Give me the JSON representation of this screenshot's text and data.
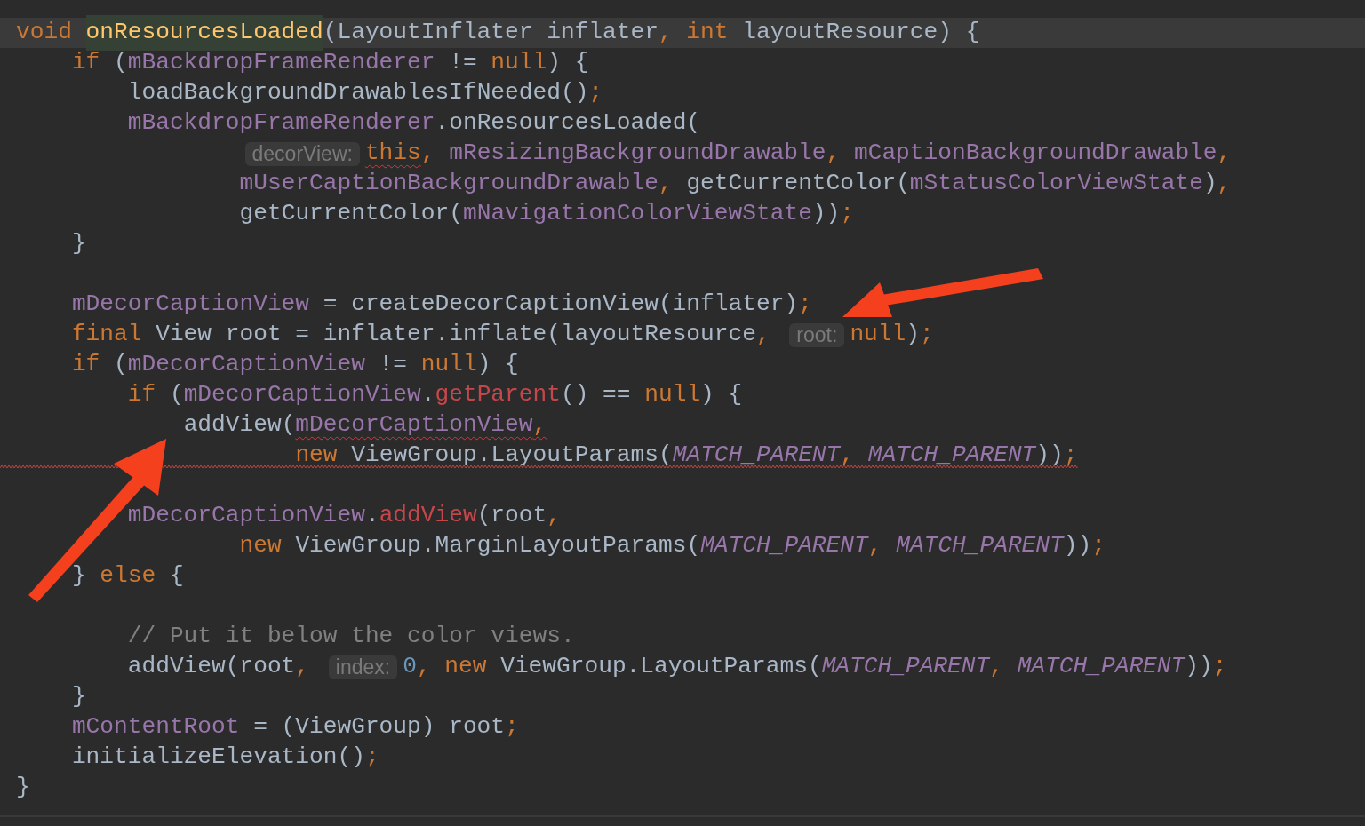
{
  "editor": {
    "lines": [
      {
        "kind": "code",
        "current": true,
        "tokens": [
          {
            "kind": "keyword",
            "text": "void "
          },
          {
            "kind": "declaration",
            "text": "onResourcesLoaded",
            "highlighted": true
          },
          {
            "kind": "plain",
            "text": "(LayoutInflater inflater"
          },
          {
            "kind": "keyword",
            "text": ", int "
          },
          {
            "kind": "plain",
            "text": "layoutResource) {"
          }
        ],
        "children": [
          {
            "kind": "code",
            "tokens": [
              {
                "kind": "keyword",
                "text": "if "
              },
              {
                "kind": "plain",
                "text": "("
              },
              {
                "kind": "field",
                "text": "mBackdropFrameRenderer"
              },
              {
                "kind": "plain",
                "text": " != "
              },
              {
                "kind": "keyword",
                "text": "null"
              },
              {
                "kind": "plain",
                "text": ") {"
              }
            ],
            "children": [
              {
                "kind": "code",
                "tokens": [
                  {
                    "kind": "plain",
                    "text": "loadBackgroundDrawablesIfNeeded()"
                  },
                  {
                    "kind": "keyword",
                    "text": ";"
                  }
                ]
              },
              {
                "kind": "code",
                "tokens": [
                  {
                    "kind": "field",
                    "text": "mBackdropFrameRenderer"
                  },
                  {
                    "kind": "plain",
                    "text": ".onResourcesLoaded("
                  }
                ]
              },
              {
                "kind": "code",
                "continuation": true,
                "tokens": [
                  {
                    "kind": "hint",
                    "text": "decorView:"
                  },
                  {
                    "kind": "keyword",
                    "text": "this",
                    "squiggle": true
                  },
                  {
                    "kind": "keyword",
                    "text": ", "
                  },
                  {
                    "kind": "field",
                    "text": "mResizingBackgroundDrawable"
                  },
                  {
                    "kind": "keyword",
                    "text": ", "
                  },
                  {
                    "kind": "field",
                    "text": "mCaptionBackgroundDrawable"
                  },
                  {
                    "kind": "keyword",
                    "text": ","
                  }
                ]
              },
              {
                "kind": "code",
                "continuation": true,
                "tokens": [
                  {
                    "kind": "field",
                    "text": "mUserCaptionBackgroundDrawable"
                  },
                  {
                    "kind": "keyword",
                    "text": ", "
                  },
                  {
                    "kind": "plain",
                    "text": "getCurrentColor("
                  },
                  {
                    "kind": "field",
                    "text": "mStatusColorViewState"
                  },
                  {
                    "kind": "plain",
                    "text": ")"
                  },
                  {
                    "kind": "keyword",
                    "text": ","
                  }
                ]
              },
              {
                "kind": "code",
                "continuation": true,
                "tokens": [
                  {
                    "kind": "plain",
                    "text": "getCurrentColor("
                  },
                  {
                    "kind": "field",
                    "text": "mNavigationColorViewState"
                  },
                  {
                    "kind": "plain",
                    "text": "))"
                  },
                  {
                    "kind": "keyword",
                    "text": ";"
                  }
                ]
              }
            ]
          },
          {
            "kind": "code",
            "tokens": [
              {
                "kind": "plain",
                "text": "}"
              }
            ]
          },
          {
            "kind": "blank"
          },
          {
            "kind": "code",
            "tokens": [
              {
                "kind": "field",
                "text": "mDecorCaptionView"
              },
              {
                "kind": "plain",
                "text": " = createDecorCaptionView(inflater)"
              },
              {
                "kind": "keyword",
                "text": ";"
              }
            ]
          },
          {
            "kind": "code",
            "tokens": [
              {
                "kind": "keyword",
                "text": "final "
              },
              {
                "kind": "plain",
                "text": "View root = inflater.inflate(layoutResource"
              },
              {
                "kind": "keyword",
                "text": ", "
              },
              {
                "kind": "hint",
                "text": "root:"
              },
              {
                "kind": "keyword",
                "text": "null"
              },
              {
                "kind": "plain",
                "text": ")"
              },
              {
                "kind": "keyword",
                "text": ";"
              }
            ]
          },
          {
            "kind": "code",
            "tokens": [
              {
                "kind": "keyword",
                "text": "if "
              },
              {
                "kind": "plain",
                "text": "("
              },
              {
                "kind": "field",
                "text": "mDecorCaptionView"
              },
              {
                "kind": "plain",
                "text": " != "
              },
              {
                "kind": "keyword",
                "text": "null"
              },
              {
                "kind": "plain",
                "text": ") {"
              }
            ],
            "children": [
              {
                "kind": "code",
                "tokens": [
                  {
                    "kind": "keyword",
                    "text": "if "
                  },
                  {
                    "kind": "plain",
                    "text": "("
                  },
                  {
                    "kind": "field",
                    "text": "mDecorCaptionView"
                  },
                  {
                    "kind": "plain",
                    "text": "."
                  },
                  {
                    "kind": "error",
                    "text": "getParent"
                  },
                  {
                    "kind": "plain",
                    "text": "() == "
                  },
                  {
                    "kind": "keyword",
                    "text": "null"
                  },
                  {
                    "kind": "plain",
                    "text": ") {"
                  }
                ],
                "children": [
                  {
                    "kind": "code",
                    "tokens": [
                      {
                        "kind": "plain",
                        "text": "addView("
                      },
                      {
                        "kind": "field",
                        "text": "mDecorCaptionView",
                        "squiggle": true
                      },
                      {
                        "kind": "keyword",
                        "text": ",",
                        "squiggle": true
                      }
                    ]
                  },
                  {
                    "kind": "code",
                    "continuation": true,
                    "squiggle": true,
                    "tokens": [
                      {
                        "kind": "keyword",
                        "text": "new "
                      },
                      {
                        "kind": "plain",
                        "text": "ViewGroup.LayoutParams("
                      },
                      {
                        "kind": "constant",
                        "text": "MATCH_PARENT"
                      },
                      {
                        "kind": "keyword",
                        "text": ", "
                      },
                      {
                        "kind": "constant",
                        "text": "MATCH_PARENT"
                      },
                      {
                        "kind": "plain",
                        "text": "))"
                      },
                      {
                        "kind": "keyword",
                        "text": ";"
                      }
                    ]
                  }
                ]
              },
              {
                "kind": "blank"
              },
              {
                "kind": "code",
                "tokens": [
                  {
                    "kind": "field",
                    "text": "mDecorCaptionView"
                  },
                  {
                    "kind": "plain",
                    "text": "."
                  },
                  {
                    "kind": "error",
                    "text": "addView"
                  },
                  {
                    "kind": "plain",
                    "text": "(root"
                  },
                  {
                    "kind": "keyword",
                    "text": ","
                  }
                ]
              },
              {
                "kind": "code",
                "continuation": true,
                "tokens": [
                  {
                    "kind": "keyword",
                    "text": "new "
                  },
                  {
                    "kind": "plain",
                    "text": "ViewGroup.MarginLayoutParams("
                  },
                  {
                    "kind": "constant",
                    "text": "MATCH_PARENT"
                  },
                  {
                    "kind": "keyword",
                    "text": ", "
                  },
                  {
                    "kind": "constant",
                    "text": "MATCH_PARENT"
                  },
                  {
                    "kind": "plain",
                    "text": "))"
                  },
                  {
                    "kind": "keyword",
                    "text": ";"
                  }
                ]
              }
            ]
          },
          {
            "kind": "code",
            "tokens": [
              {
                "kind": "plain",
                "text": "} "
              },
              {
                "kind": "keyword",
                "text": "else "
              },
              {
                "kind": "plain",
                "text": "{"
              }
            ],
            "children": [
              {
                "kind": "blank"
              },
              {
                "kind": "code",
                "tokens": [
                  {
                    "kind": "comment",
                    "text": "// Put it below the color views."
                  }
                ]
              },
              {
                "kind": "code",
                "tokens": [
                  {
                    "kind": "plain",
                    "text": "addView(root"
                  },
                  {
                    "kind": "keyword",
                    "text": ", "
                  },
                  {
                    "kind": "hint",
                    "text": "index:"
                  },
                  {
                    "kind": "number",
                    "text": "0"
                  },
                  {
                    "kind": "keyword",
                    "text": ", new "
                  },
                  {
                    "kind": "plain",
                    "text": "ViewGroup.LayoutParams("
                  },
                  {
                    "kind": "constant",
                    "text": "MATCH_PARENT"
                  },
                  {
                    "kind": "keyword",
                    "text": ", "
                  },
                  {
                    "kind": "constant",
                    "text": "MATCH_PARENT"
                  },
                  {
                    "kind": "plain",
                    "text": "))"
                  },
                  {
                    "kind": "keyword",
                    "text": ";"
                  }
                ]
              }
            ]
          },
          {
            "kind": "code",
            "tokens": [
              {
                "kind": "plain",
                "text": "}"
              }
            ]
          },
          {
            "kind": "code",
            "tokens": [
              {
                "kind": "field",
                "text": "mContentRoot"
              },
              {
                "kind": "plain",
                "text": " = (ViewGroup) root"
              },
              {
                "kind": "keyword",
                "text": ";"
              }
            ]
          },
          {
            "kind": "code",
            "tokens": [
              {
                "kind": "plain",
                "text": "initializeElevation()"
              },
              {
                "kind": "keyword",
                "text": ";"
              }
            ]
          }
        ]
      },
      {
        "kind": "code",
        "tokens": [
          {
            "kind": "plain",
            "text": "}"
          }
        ]
      }
    ]
  }
}
